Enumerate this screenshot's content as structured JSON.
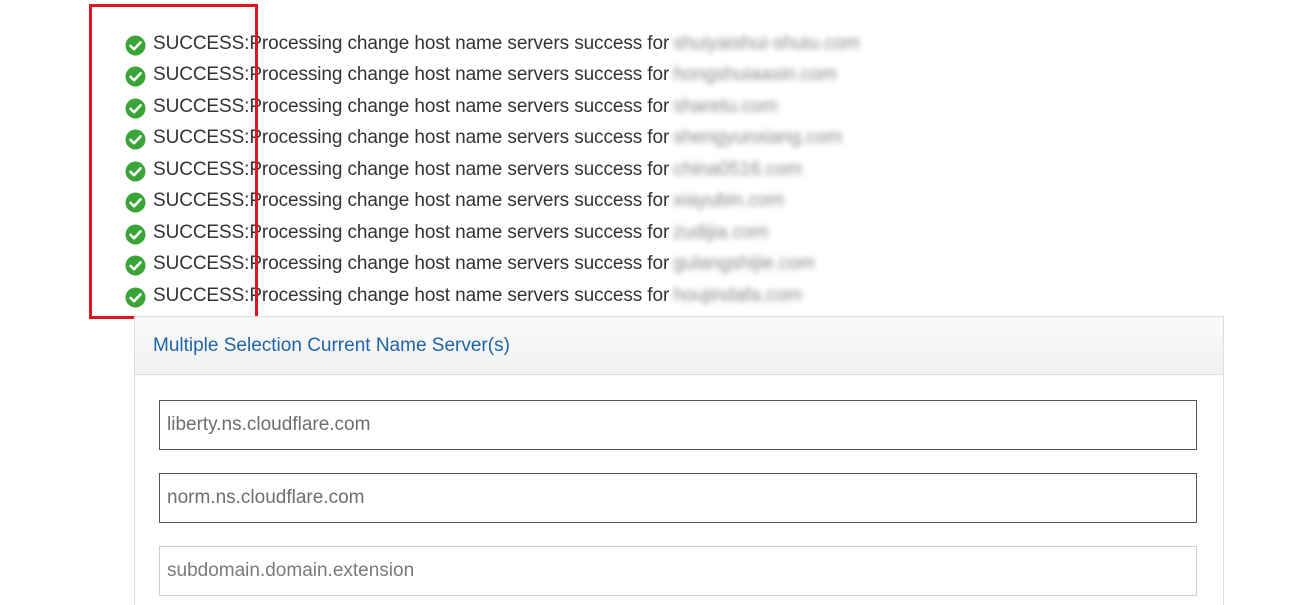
{
  "messages": [
    {
      "status": "SUCCESS:",
      "text": "Processing change host name servers success for",
      "domain": "shuiyaishui-shuiu.com"
    },
    {
      "status": "SUCCESS:",
      "text": "Processing change host name servers success for",
      "domain": "hongshuiaaxin.com"
    },
    {
      "status": "SUCCESS:",
      "text": "Processing change host name servers success for",
      "domain": "sharetu.com"
    },
    {
      "status": "SUCCESS:",
      "text": "Processing change host name servers success for",
      "domain": "shengyunxiang.com"
    },
    {
      "status": "SUCCESS:",
      "text": "Processing change host name servers success for",
      "domain": "china0516.com"
    },
    {
      "status": "SUCCESS:",
      "text": "Processing change host name servers success for",
      "domain": "xiayubin.com"
    },
    {
      "status": "SUCCESS:",
      "text": "Processing change host name servers success for",
      "domain": "zudijia.com"
    },
    {
      "status": "SUCCESS:",
      "text": "Processing change host name servers success for",
      "domain": "gulangshijie.com"
    },
    {
      "status": "SUCCESS:",
      "text": "Processing change host name servers success for",
      "domain": "houjindafa.com"
    }
  ],
  "colors": {
    "success_icon": "#3aa537",
    "highlight_border": "#e0161d",
    "panel_title": "#1d64a8"
  },
  "icons": {
    "message": "check-circle-icon"
  },
  "panel": {
    "title": "Multiple Selection Current Name Server(s)",
    "fields": [
      {
        "value": "liberty.ns.cloudflare.com",
        "placeholder": ""
      },
      {
        "value": "norm.ns.cloudflare.com",
        "placeholder": ""
      },
      {
        "value": "",
        "placeholder": "subdomain.domain.extension"
      }
    ]
  }
}
